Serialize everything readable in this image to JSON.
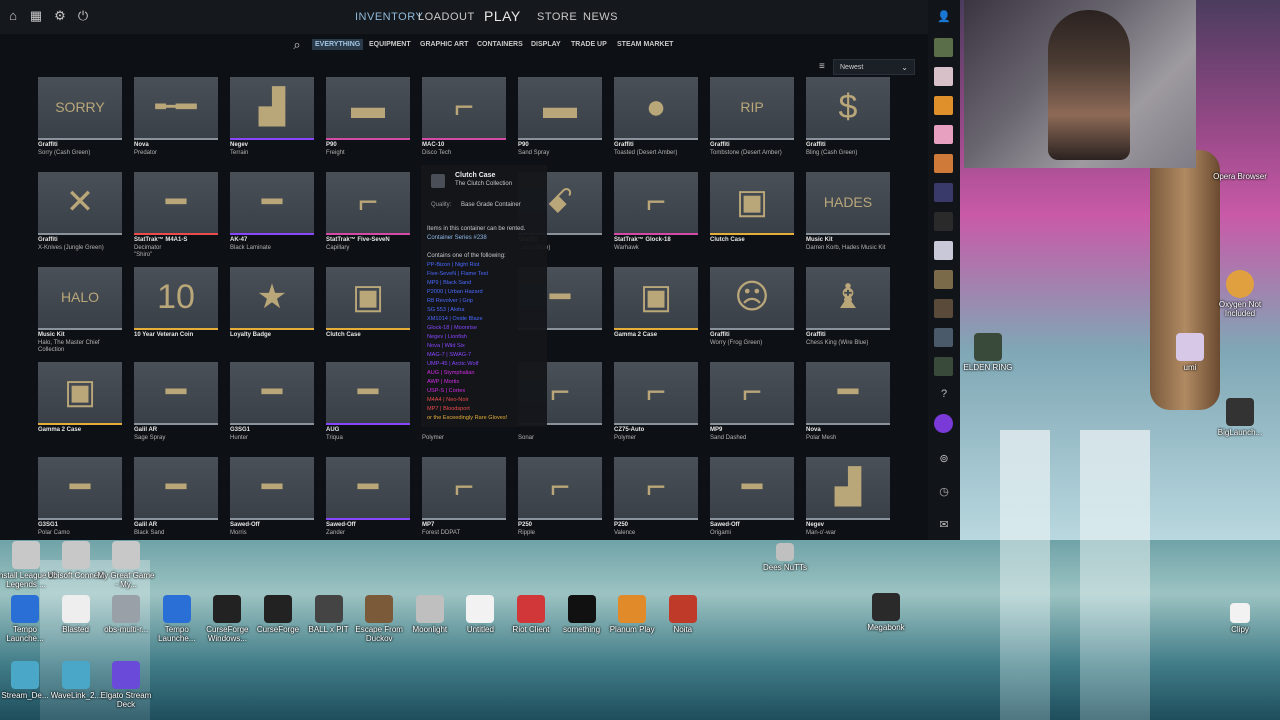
{
  "topbar": {
    "nav": [
      {
        "label": "INVENTORY",
        "active": true
      },
      {
        "label": "LOADOUT",
        "active": false
      },
      {
        "label": "PLAY",
        "active": false
      },
      {
        "label": "STORE",
        "active": false
      },
      {
        "label": "NEWS",
        "active": false
      }
    ]
  },
  "subnav": {
    "tabs": [
      {
        "label": "EVERYTHING",
        "active": true
      },
      {
        "label": "EQUIPMENT"
      },
      {
        "label": "GRAPHIC ART"
      },
      {
        "label": "CONTAINERS"
      },
      {
        "label": "DISPLAY"
      },
      {
        "label": "TRADE UP"
      },
      {
        "label": "STEAM MARKET"
      }
    ],
    "sort_value": "Newest"
  },
  "items": [
    {
      "name": "Graffiti",
      "sub": "Sorry (Cash Green)",
      "glyph": "SORRY"
    },
    {
      "name": "Nova",
      "sub": "Predator",
      "glyph": "╾━"
    },
    {
      "name": "Negev",
      "sub": "Terrain",
      "glyph": "▟"
    },
    {
      "name": "P90",
      "sub": "Freight",
      "glyph": "▬"
    },
    {
      "name": "MAC-10",
      "sub": "Disco Tech",
      "glyph": "⌐"
    },
    {
      "name": "P90",
      "sub": "Sand Spray",
      "glyph": "▬"
    },
    {
      "name": "Graffiti",
      "sub": "Toasted (Desert Amber)",
      "glyph": "●"
    },
    {
      "name": "Graffiti",
      "sub": "Tombstone (Desert Amber)",
      "glyph": "RIP"
    },
    {
      "name": "Graffiti",
      "sub": "Bling (Cash Green)",
      "glyph": "$"
    },
    {
      "name": "Graffiti",
      "sub": "X-Knives (Jungle Green)",
      "glyph": "✕"
    },
    {
      "name": "StatTrak™ M4A1-S",
      "sub": "Decimator",
      "sub2": "\"Shiro\"",
      "glyph": "━"
    },
    {
      "name": "AK-47",
      "sub": "Black Laminate",
      "glyph": "━"
    },
    {
      "name": "StatTrak™ Five-SeveN",
      "sub": "Capillary",
      "glyph": "⌐"
    },
    {
      "name": "",
      "sub": "",
      "glyph": ""
    },
    {
      "name": "Graffiti",
      "sub": "...arch Blue)",
      "glyph": "ꗃ"
    },
    {
      "name": "StatTrak™ Glock-18",
      "sub": "Warhawk",
      "glyph": "⌐"
    },
    {
      "name": "Clutch Case",
      "sub": "",
      "glyph": "▣"
    },
    {
      "name": "Music Kit",
      "sub": "Darren Korb, Hades Music Kit",
      "glyph": "HADES"
    },
    {
      "name": "Music Kit",
      "sub": "Halo, The Master Chief",
      "sub2": "Collection",
      "glyph": "HALO"
    },
    {
      "name": "10 Year Veteran Coin",
      "sub": "",
      "glyph": "10"
    },
    {
      "name": "Loyalty Badge",
      "sub": "",
      "glyph": "★"
    },
    {
      "name": "Clutch Case",
      "sub": "",
      "glyph": "▣"
    },
    {
      "name": "",
      "sub": "",
      "glyph": ""
    },
    {
      "name": "",
      "sub": "",
      "glyph": "━"
    },
    {
      "name": "Gamma 2 Case",
      "sub": "",
      "glyph": "▣"
    },
    {
      "name": "Graffiti",
      "sub": "Worry (Frog Green)",
      "glyph": "☹"
    },
    {
      "name": "Graffiti",
      "sub": "Chess King (Wire Blue)",
      "glyph": "♝"
    },
    {
      "name": "Gamma 2 Case",
      "sub": "",
      "glyph": "▣"
    },
    {
      "name": "Galil AR",
      "sub": "Sage Spray",
      "glyph": "━"
    },
    {
      "name": "G3SG1",
      "sub": "Hunter",
      "glyph": "━"
    },
    {
      "name": "AUG",
      "sub": "Triqua",
      "glyph": "━"
    },
    {
      "name": "",
      "sub": "Polymer",
      "glyph": ""
    },
    {
      "name": "",
      "sub": "Sonar",
      "glyph": "⌐"
    },
    {
      "name": "CZ75-Auto",
      "sub": "Polymer",
      "glyph": "⌐"
    },
    {
      "name": "MP9",
      "sub": "Sand Dashed",
      "glyph": "⌐"
    },
    {
      "name": "Nova",
      "sub": "Polar Mesh",
      "glyph": "━"
    },
    {
      "name": "G3SG1",
      "sub": "Polar Camo",
      "glyph": "━"
    },
    {
      "name": "Galil AR",
      "sub": "Black Sand",
      "glyph": "━"
    },
    {
      "name": "Sawed-Off",
      "sub": "Morris",
      "glyph": "━"
    },
    {
      "name": "Sawed-Off",
      "sub": "Zander",
      "glyph": "━"
    },
    {
      "name": "MP7",
      "sub": "Forest DDPAT",
      "glyph": "⌐"
    },
    {
      "name": "P250",
      "sub": "Ripple",
      "glyph": "⌐"
    },
    {
      "name": "P250",
      "sub": "Valence",
      "glyph": "⌐"
    },
    {
      "name": "Sawed-Off",
      "sub": "Origami",
      "glyph": "━"
    },
    {
      "name": "Negev",
      "sub": "Man-o'-war",
      "glyph": "▟"
    }
  ],
  "tooltip": {
    "title": "Clutch Case",
    "collection": "The Clutch Collection",
    "quality_label": "Quality:",
    "quality_value": "Base Grade Container",
    "rent_text": "Items in this container can be rented.",
    "series": "Container Series #238",
    "contains_label": "Contains one of the following:",
    "contents": [
      {
        "text": "PP-Bizon | Night Riot",
        "color": "#4b69ff"
      },
      {
        "text": "Five-SeveN | Flame Test",
        "color": "#4b69ff"
      },
      {
        "text": "MP9 | Black Sand",
        "color": "#4b69ff"
      },
      {
        "text": "P2000 | Urban Hazard",
        "color": "#4b69ff"
      },
      {
        "text": "R8 Revolver | Grip",
        "color": "#4b69ff"
      },
      {
        "text": "SG 553 | Aloha",
        "color": "#4b69ff"
      },
      {
        "text": "XM1014 | Oxide Blaze",
        "color": "#4b69ff"
      },
      {
        "text": "Glock-18 | Moonrise",
        "color": "#8847ff"
      },
      {
        "text": "Negev | Lionfish",
        "color": "#8847ff"
      },
      {
        "text": "Nova | Wild Six",
        "color": "#8847ff"
      },
      {
        "text": "MAG-7 | SWAG-7",
        "color": "#8847ff"
      },
      {
        "text": "UMP-45 | Arctic Wolf",
        "color": "#8847ff"
      },
      {
        "text": "AUG | Stymphalian",
        "color": "#d32ce6"
      },
      {
        "text": "AWP | Mortis",
        "color": "#d32ce6"
      },
      {
        "text": "USP-S | Cortex",
        "color": "#d32ce6"
      },
      {
        "text": "M4A4 | Neo-Noir",
        "color": "#eb4b4b"
      },
      {
        "text": "MP7 | Bloodsport",
        "color": "#eb4b4b"
      },
      {
        "text": "or the Exceedingly Rare Gloves!",
        "color": "#e4ae39"
      }
    ]
  },
  "desktop": {
    "top_row": [
      {
        "label": "Install League of Legends ..."
      },
      {
        "label": "Ubisoft Connect"
      },
      {
        "label": "My Great Game - My..."
      }
    ],
    "row1": [
      {
        "label": "Tempo Launche...",
        "color": "#2a6fd6"
      },
      {
        "label": "Blasted",
        "color": "#eeeeee"
      },
      {
        "label": "obs-multi-r...",
        "color": "#9aa0a8"
      },
      {
        "label": "Tempo Launche...",
        "color": "#2a6fd6"
      },
      {
        "label": "CurseForge Windows...",
        "color": "#222222"
      },
      {
        "label": "CurseForge",
        "color": "#222222"
      },
      {
        "label": "BALL x PIT",
        "color": "#444444"
      },
      {
        "label": "Escape From Duckov",
        "color": "#7b5a3a"
      },
      {
        "label": "Moonlight",
        "color": "#bfbfbf"
      },
      {
        "label": "Untitled",
        "color": "#f2f2f2"
      },
      {
        "label": "Riot Client",
        "color": "#d13639"
      },
      {
        "label": "something",
        "color": "#111111"
      },
      {
        "label": "Planum Play",
        "color": "#e08a2a"
      },
      {
        "label": "Noita",
        "color": "#c03a2a"
      }
    ],
    "row2": [
      {
        "label": "Stream_De...",
        "color": "#4aa7c8"
      },
      {
        "label": "WaveLink_2...",
        "color": "#4aa7c8"
      },
      {
        "label": "Elgato Stream Deck",
        "color": "#6a4ad8"
      }
    ],
    "megabonk": "Megabonk",
    "dees": "Dees NuTTs",
    "clipy": "Clipy",
    "opera": "Opera Browser",
    "oxygen": "Oxygen Not Included",
    "elden": "ELDEN RING",
    "umi": "umi",
    "biglaunch": "BigLaunch..."
  }
}
